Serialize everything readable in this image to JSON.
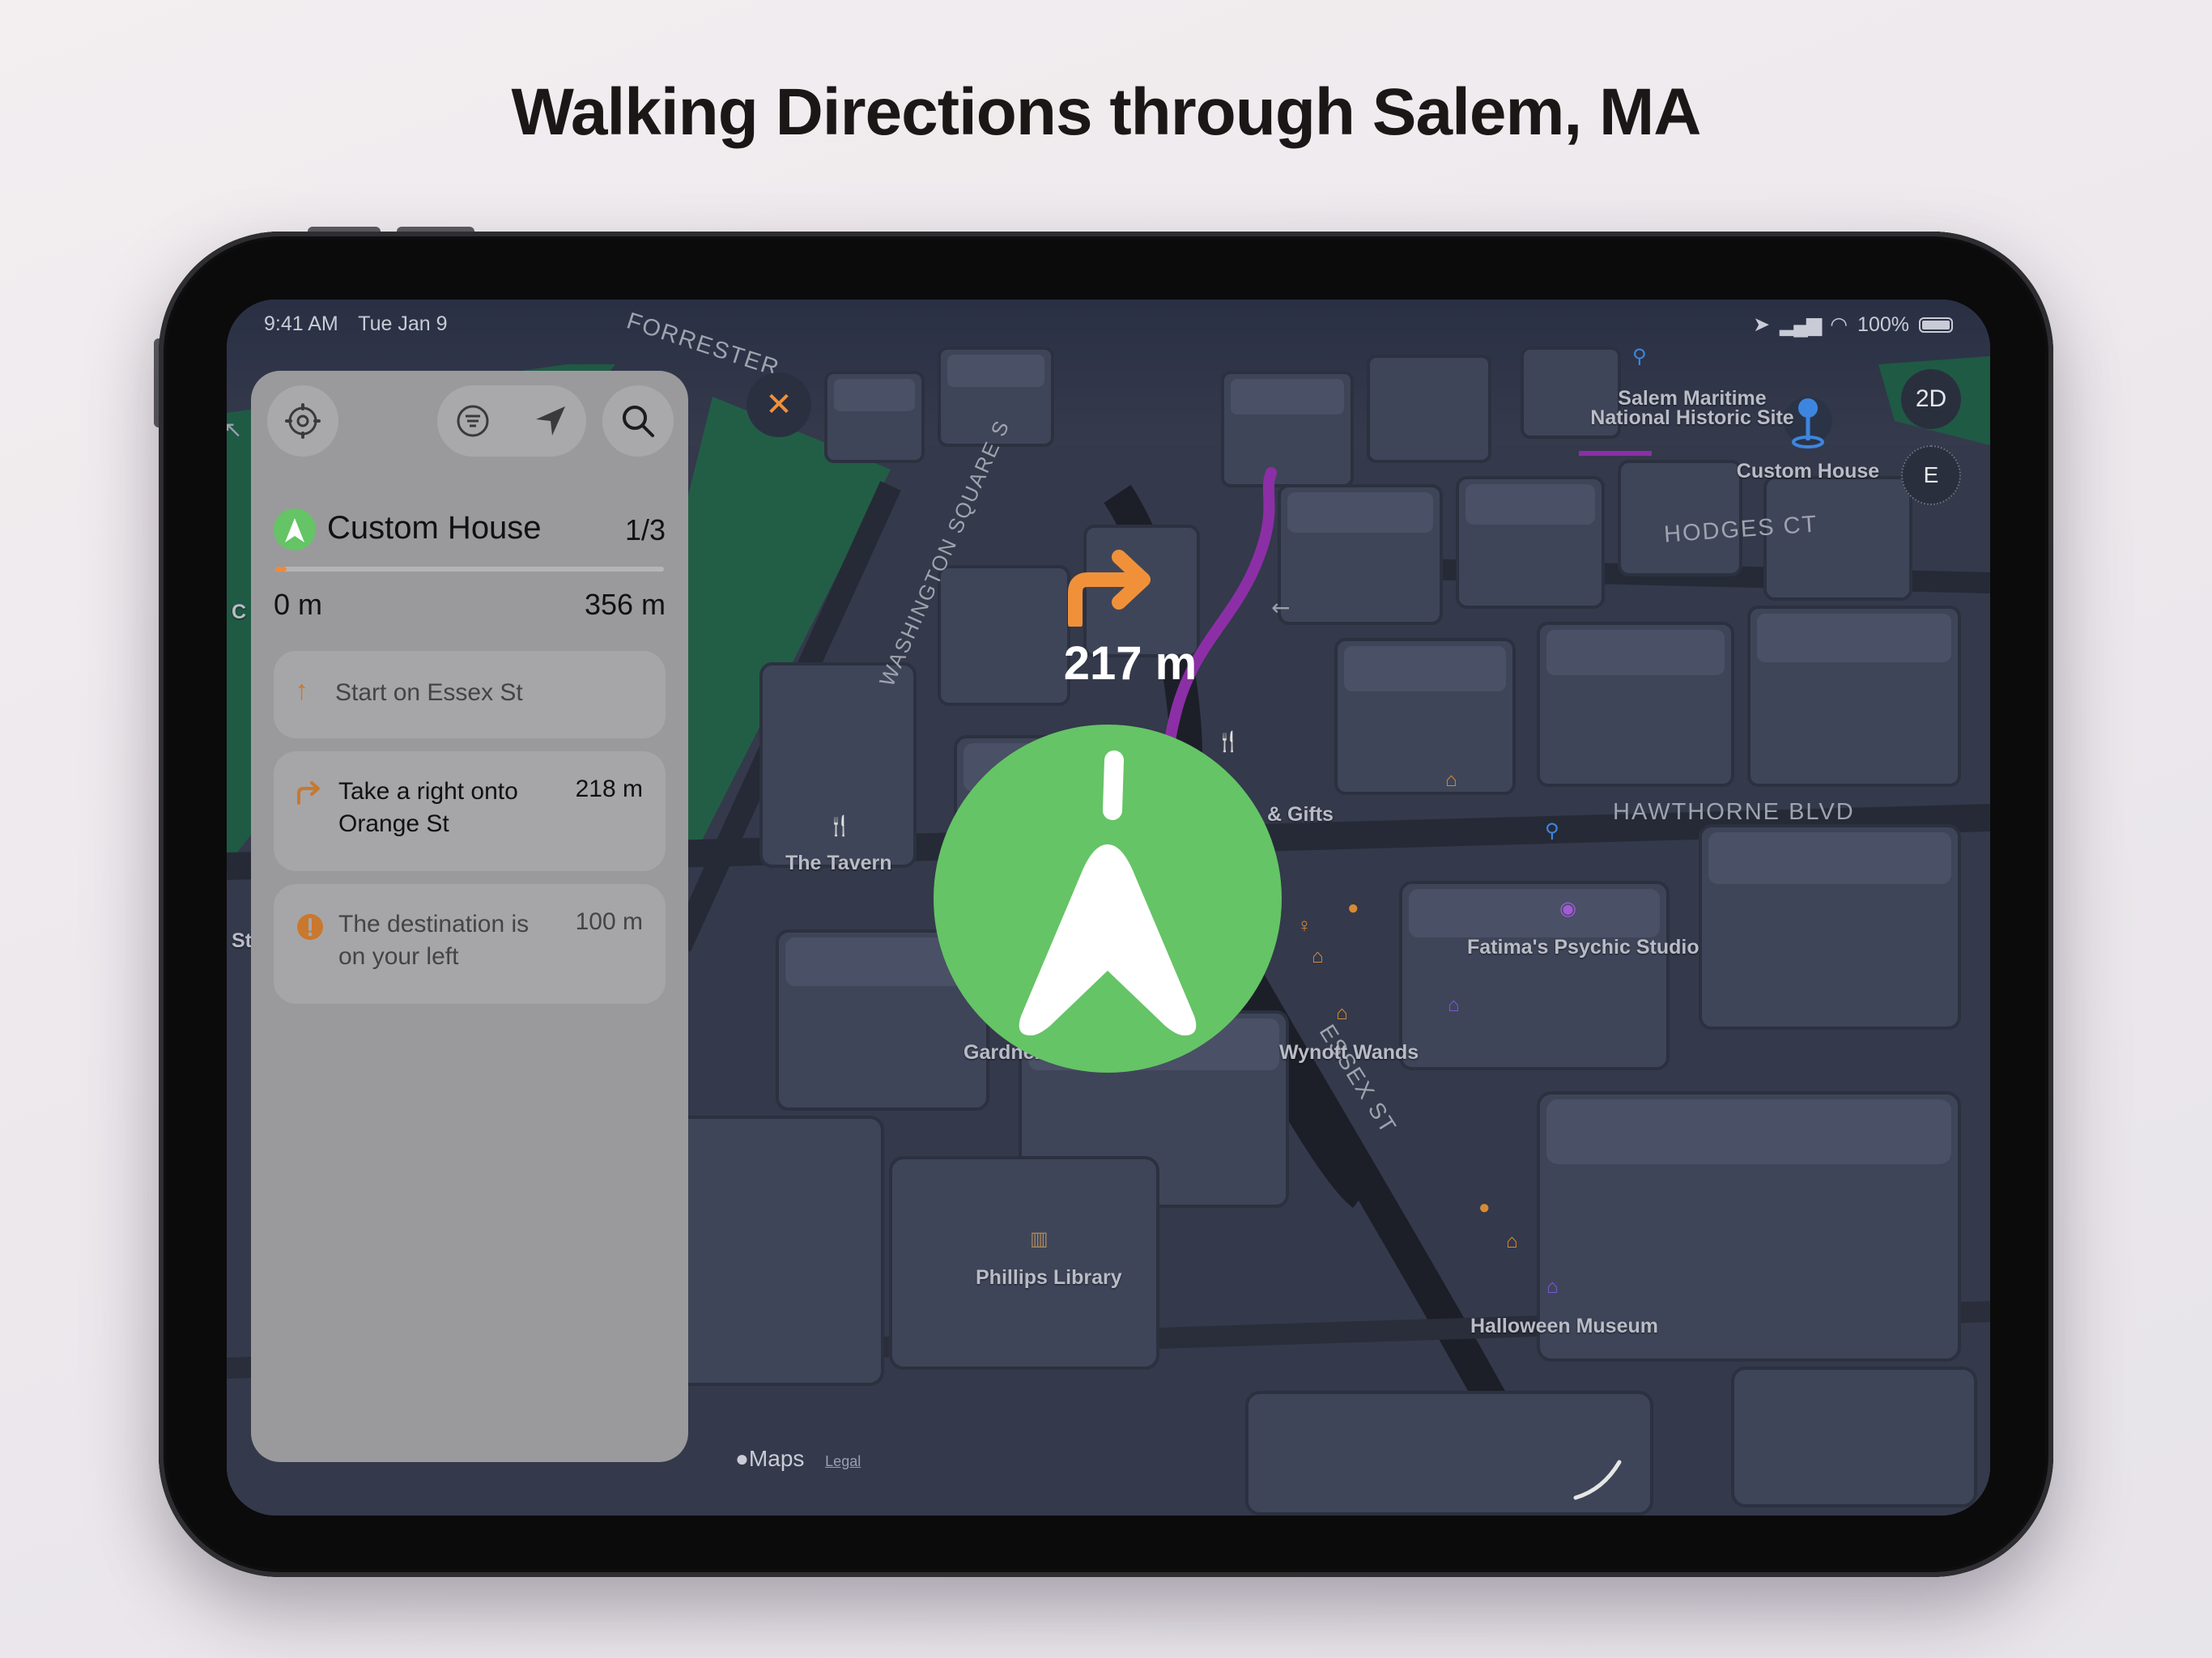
{
  "headline": "Walking Directions through Salem, MA",
  "status_bar": {
    "time": "9:41 AM",
    "date": "Tue Jan 9",
    "battery": "100%"
  },
  "navigation": {
    "turn_distance": "217 m",
    "turn_icon": "turn-right-arrow-icon",
    "route_color": "#8c2fa6",
    "accent_color": "#f0913a",
    "puck_color": "#65c466"
  },
  "panel": {
    "destination": "Custom House",
    "step_counter": "1/3",
    "distance_start": "0 m",
    "distance_total": "356 m",
    "progress_fraction": 0.03,
    "steps": [
      {
        "icon": "arrow-up-icon",
        "text": "Start on Essex St",
        "distance": ""
      },
      {
        "icon": "turn-right-icon",
        "text": "Take a right onto Orange St",
        "distance": "218 m"
      },
      {
        "icon": "destination-pin-icon",
        "text": "The destination is on your left",
        "distance": "100 m"
      }
    ]
  },
  "map": {
    "mode_button": "2D",
    "compass": "E",
    "streets": [
      "FORRESTER",
      "WASHINGTON SQUARE S",
      "HODGES CT",
      "HAWTHORNE BLVD",
      "ESSEX ST"
    ],
    "places": {
      "maritime_line1": "Salem Maritime",
      "maritime_line2": "National Historic Site",
      "custom_house": "Custom House",
      "tavern": "The Tavern",
      "gifts": "& Gifts",
      "psychic": "Fatima's Psychic Studio",
      "gardner": "Gardner",
      "gardner_tail": "e",
      "wynott": "Wynott Wands",
      "phillips": "Phillips Library",
      "halloween": "Halloween Museum",
      "edge_c": "C",
      "edge_st": "St"
    },
    "attribution": "Maps",
    "legal": "Legal"
  }
}
